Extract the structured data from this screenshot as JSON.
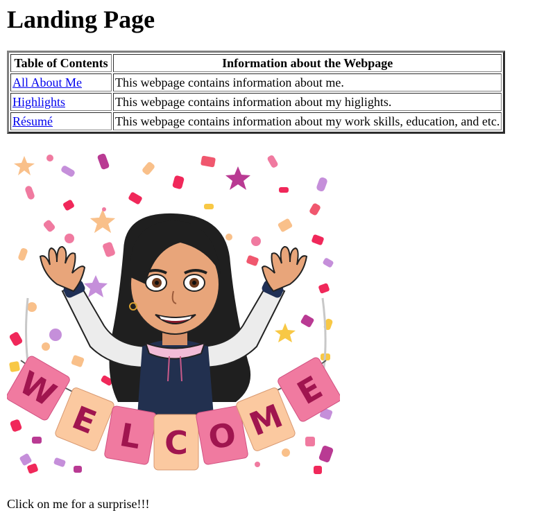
{
  "page": {
    "title": "Landing Page"
  },
  "table": {
    "headers": [
      "Table of Contents",
      "Information about the Webpage"
    ],
    "rows": [
      {
        "link": "All About Me",
        "info": "This webpage contains information about me."
      },
      {
        "link": "Highlights",
        "info": "This webpage contains information about my higlights."
      },
      {
        "link": "Résumé",
        "info": "This webpage contains information about my work skills, education, and etc."
      }
    ]
  },
  "image": {
    "banner_text": "WELCOME",
    "description_icon": "bitmoji-avatar-icon"
  },
  "caption": "Click on me for a surprise!!!",
  "colors": {
    "link": "#0000ee",
    "banner_pink": "#f07aa0",
    "banner_peach": "#fbc9a0",
    "letters": "#a0154f"
  }
}
